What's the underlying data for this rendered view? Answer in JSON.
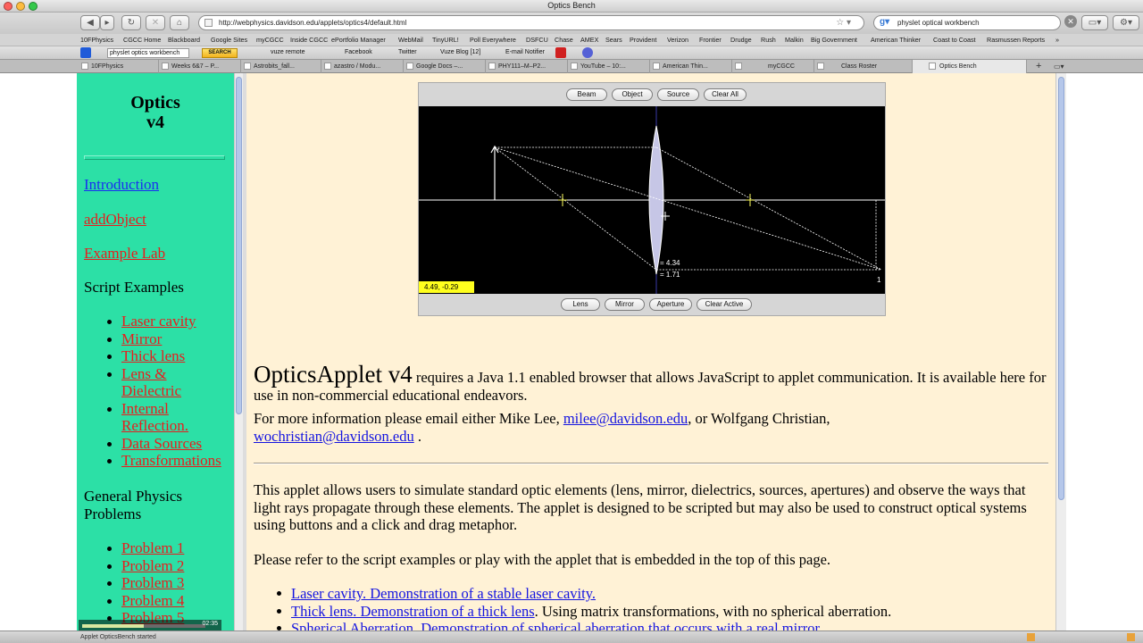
{
  "window": {
    "title": "Optics Bench"
  },
  "nav": {
    "url": "http://webphysics.davidson.edu/applets/optics4/default.html",
    "search_value": "physlet optical workbench"
  },
  "bookmarks": [
    "10FPhysics",
    "CGCC Home",
    "Blackboard",
    "Google Sites",
    "myCGCC",
    "Inside CGCC",
    "ePortfolio Manager",
    "WebMail",
    "TinyURL!",
    "Poll Everywhere",
    "DSFCU",
    "Chase",
    "AMEX",
    "Sears",
    "Provident",
    "Verizon",
    "Frontier",
    "Drudge",
    "Rush",
    "Malkin",
    "Big Government",
    "American Thinker",
    "Coast to Coast",
    "Rasmussen Reports"
  ],
  "toolbar": {
    "search_value": "physlet optics workbench",
    "search_button": "SEARCH",
    "items": [
      "vuze remote",
      "Facebook",
      "Twitter",
      "Vuze Blog [12]",
      "E-mail Notifier"
    ]
  },
  "tabs": [
    "10FPhysics",
    "Weeks 6&7 – P...",
    "Astrobits_fall...",
    "azastro / Modu...",
    "Google Docs –...",
    "PHY111–M–P2...",
    "YouTube – 10:...",
    "American Thin...",
    "myCGCC",
    "Class Roster",
    "Optics Bench"
  ],
  "sidebar": {
    "title_line1": "Optics",
    "title_line2": "v4",
    "links": {
      "introduction": "Introduction",
      "add_object": "addObject",
      "example_lab": "Example Lab"
    },
    "script_examples_heading": "Script Examples",
    "script_examples": [
      "Laser cavity",
      "Mirror",
      "Thick lens",
      "Lens &",
      "Dielectric",
      "Internal",
      "Reflection.",
      "Data Sources",
      "Transformations"
    ],
    "general_heading_line1": "General Physics",
    "general_heading_line2": "Problems",
    "problems": [
      "Problem 1",
      "Problem 2",
      "Problem 3",
      "Problem 4",
      "Problem 5"
    ]
  },
  "applet": {
    "top_buttons": [
      "Beam",
      "Object",
      "Source",
      "Clear All"
    ],
    "bottom_buttons": [
      "Lens",
      "Mirror",
      "Aperture",
      "Clear Active"
    ],
    "coord_readout": "4.49, -0.29",
    "lens_label_1": "= 4.34",
    "lens_label_2": "= 1.71",
    "index_label": "1"
  },
  "main": {
    "heading_big": "OpticsApplet v4",
    "intro_rest": " requires a Java 1.1 enabled browser that allows JavaScript to applet communication. It is available here for use in non-commercial educational endeavors.",
    "contact_prefix": "For more information please email either Mike Lee, ",
    "email_1": "milee@davidson.edu",
    "contact_mid": ",   or Wolfgang Christian,",
    "email_2": "wochristian@davidson.edu",
    "contact_end": " .",
    "para_1": "This applet allows users to simulate standard optic elements (lens, mirror, dielectrics, sources, apertures) and observe the ways that light rays propagate through these elements. The applet is designed to be scripted but may also be used to construct optical systems using buttons and a click and drag metaphor.",
    "para_2": "Please refer to the script examples or play with the applet that is embedded in the top of this page.",
    "list": [
      {
        "link": "Laser cavity. Demonstration of a stable laser cavity.",
        "rest": ""
      },
      {
        "link": "Thick lens. Demonstration of a thick lens",
        "rest": ". Using matrix transformations, with no spherical aberration."
      },
      {
        "link": "Spherical Aberration. Demonstration of spherical aberration that occurs with a real mirror",
        "rest": "."
      }
    ]
  },
  "video": {
    "time": "02:35",
    "progress": 0.5
  },
  "status": {
    "text": "Applet OpticsBench started"
  }
}
